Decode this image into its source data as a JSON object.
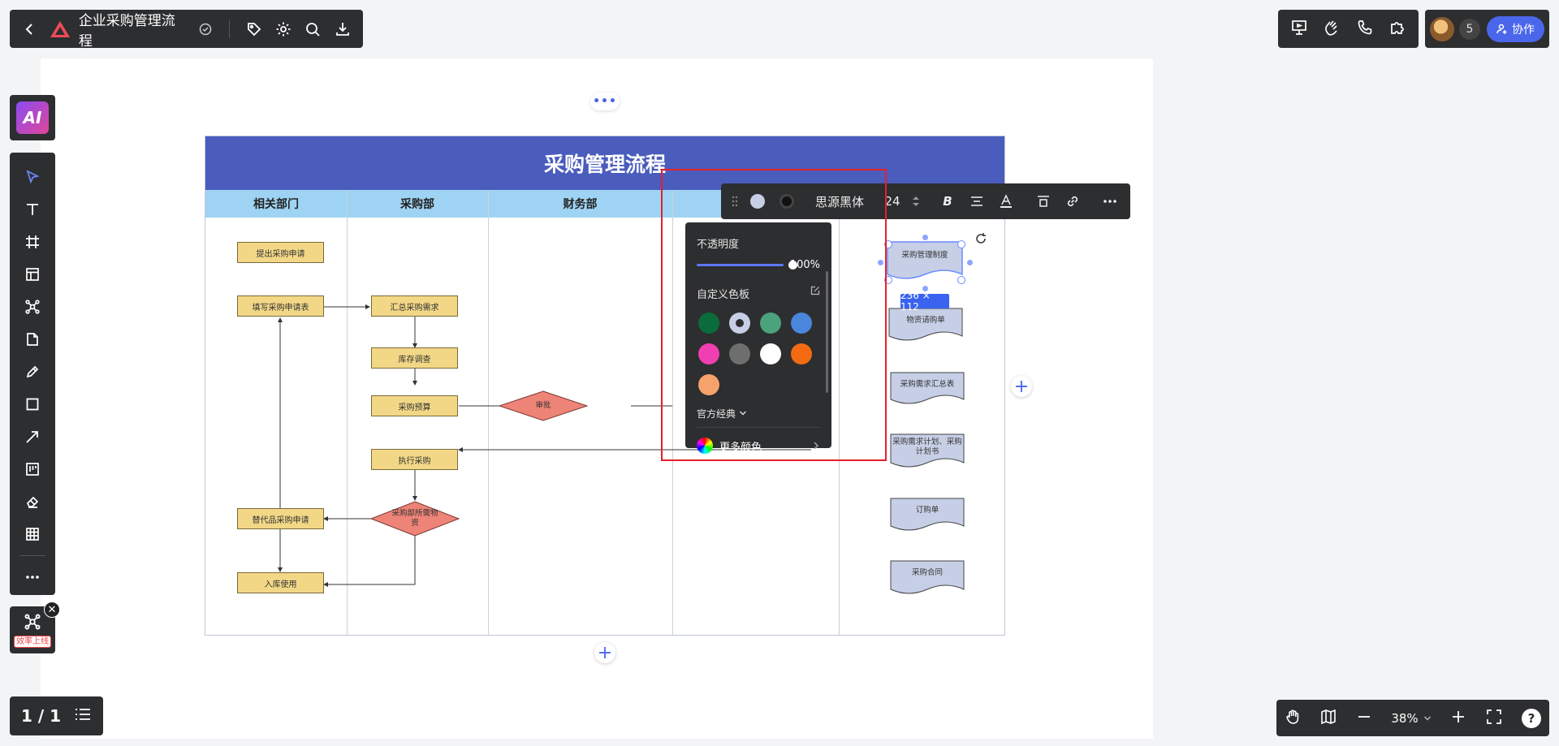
{
  "app": {
    "doc_title": "企业采购管理流程",
    "ai_label": "AI"
  },
  "top_right": {
    "collaborator_count": "5",
    "collab_label": "协作"
  },
  "mindmap_card": {
    "tag": "效率上线"
  },
  "page_nav": {
    "page_indicator": "1 / 1"
  },
  "zoom": {
    "value": "38%",
    "help": "?"
  },
  "diagram": {
    "title": "采购管理流程",
    "lanes": [
      "相关部门",
      "采购部",
      "财务部",
      "",
      ""
    ],
    "nodes": {
      "n1": "提出采购申请",
      "n2": "填写采购申请表",
      "n3": "汇总采购需求",
      "n4": "库存调查",
      "n5": "采购预算",
      "n6": "执行采购",
      "n7": "替代品采购申请",
      "n8": "入库使用",
      "d1": "审批",
      "d2": "采购部所需物资"
    },
    "documents": {
      "doc1": "采购管理制度",
      "doc2": "物资请购单",
      "doc3": "采购需求汇总表",
      "doc4": "采购需求计划、采购计划书",
      "doc5": "订购单",
      "doc6": "采购合同"
    },
    "selection_size": "236 × 112"
  },
  "format_toolbar": {
    "font_family": "思源黑体",
    "font_size": "24",
    "bold": "B"
  },
  "color_popover": {
    "opacity_label": "不透明度",
    "opacity_value": "100%",
    "opacity_fraction": 1.0,
    "custom_palette_label": "自定义色板",
    "swatches": [
      "#0b6b3a",
      "#c7cfe6",
      "#4aa37c",
      "#4a86dc",
      "#f03fb0",
      "#6e6e6e",
      "#ffffff",
      "#f26b12",
      "#f6a26b"
    ],
    "selected_swatch_index": 1,
    "classic_label": "官方经典",
    "more_colors_label": "更多颜色"
  },
  "colors": {
    "accent": "#4a66ea",
    "toolbar_bg": "#2d2e30",
    "title_bar": "#4a5cbc",
    "lane_header": "#9fd3f3",
    "process_fill": "#f2d786",
    "decision_fill": "#ee8378",
    "document_fill": "#c6cfe6",
    "highlight_box": "#e5202b"
  }
}
